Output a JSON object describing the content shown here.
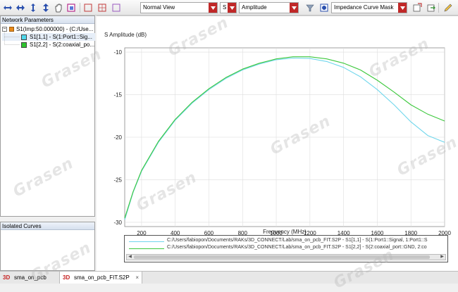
{
  "toolbar": {
    "view_dropdown": "Normal View",
    "param_dropdown": "S",
    "format_dropdown": "Amplitude",
    "mask_dropdown": "Impedance Curve Mask"
  },
  "network_panel": {
    "title": "Network Parameters",
    "root_label": "S1(Imp:50.000000) - (C:/Use...",
    "items": [
      {
        "label": "S1[1,1] - S(1:Port1::Sig...",
        "color": "#4fd8ec"
      },
      {
        "label": "S1[2,2] - S(2:coaxial_po...",
        "color": "#2ec42e"
      }
    ]
  },
  "isolated_panel": {
    "title": "Isolated Curves"
  },
  "chart_data": {
    "type": "line",
    "ylabel": "S Amplitude (dB)",
    "xlabel": "Frequency (MHz)",
    "xlim": [
      100,
      2000
    ],
    "ylim": [
      -30.5,
      -9.5
    ],
    "xticks": [
      "200",
      "400",
      "600",
      "800",
      "1000",
      "1200",
      "1400",
      "1600",
      "1800",
      "2000"
    ],
    "yticks": [
      "-10",
      "-15",
      "-20",
      "-25",
      "-30"
    ],
    "grid": true,
    "series": [
      {
        "name": "C:/Users/fabiopon/Documents/RAKs/3D_CONNECT/Lab/sma_on_pcb_FIT.S2P - S1[1,1] - S(1:Port1::Signal, 1:Port1::S",
        "color": "#6fd6ec",
        "x": [
          100,
          150,
          200,
          300,
          400,
          500,
          600,
          700,
          800,
          900,
          1000,
          1100,
          1200,
          1300,
          1400,
          1500,
          1600,
          1700,
          1800,
          1900,
          2000
        ],
        "y": [
          -29.7,
          -26.5,
          -24.0,
          -20.6,
          -18.0,
          -16.0,
          -14.4,
          -13.1,
          -12.1,
          -11.4,
          -10.9,
          -10.7,
          -10.75,
          -11.1,
          -11.8,
          -12.9,
          -14.4,
          -16.2,
          -18.2,
          -19.8,
          -20.6
        ]
      },
      {
        "name": "C:/Users/fabiopon/Documents/RAKs/3D_CONNECT/Lab/sma_on_pcb_FIT.S2P - S1[2,2] - S(2:coaxial_port::GND, 2:co",
        "color": "#3cc83c",
        "x": [
          100,
          150,
          200,
          300,
          400,
          500,
          600,
          700,
          800,
          900,
          1000,
          1100,
          1200,
          1300,
          1400,
          1500,
          1600,
          1700,
          1800,
          1900,
          2000
        ],
        "y": [
          -29.5,
          -26.4,
          -23.9,
          -20.5,
          -17.9,
          -15.9,
          -14.3,
          -13.0,
          -12.0,
          -11.3,
          -10.8,
          -10.55,
          -10.55,
          -10.8,
          -11.3,
          -12.1,
          -13.3,
          -14.7,
          -16.2,
          -17.3,
          -18.1
        ]
      }
    ],
    "legend": "bottom"
  },
  "tabs": [
    {
      "label": "sma_on_pcb",
      "icon": "3D"
    },
    {
      "label": "sma_on_pcb_FIT.S2P",
      "icon": "3D",
      "close": "×"
    }
  ],
  "watermark": "Grasen"
}
